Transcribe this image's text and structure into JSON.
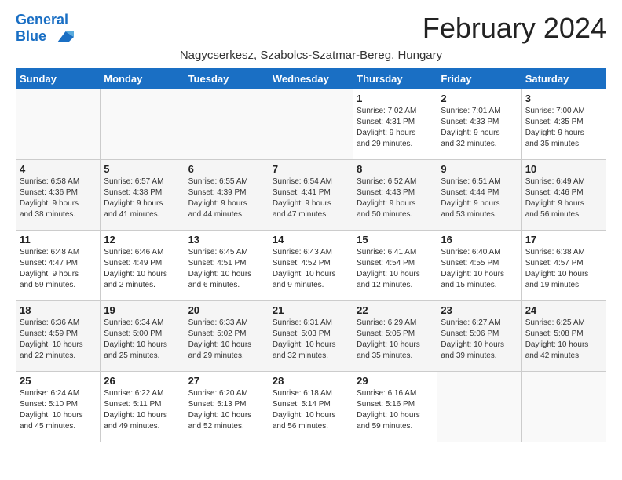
{
  "header": {
    "logo_line1": "General",
    "logo_line2": "Blue",
    "month_title": "February 2024",
    "location": "Nagycserkesz, Szabolcs-Szatmar-Bereg, Hungary"
  },
  "weekdays": [
    "Sunday",
    "Monday",
    "Tuesday",
    "Wednesday",
    "Thursday",
    "Friday",
    "Saturday"
  ],
  "weeks": [
    [
      {
        "day": "",
        "info": ""
      },
      {
        "day": "",
        "info": ""
      },
      {
        "day": "",
        "info": ""
      },
      {
        "day": "",
        "info": ""
      },
      {
        "day": "1",
        "info": "Sunrise: 7:02 AM\nSunset: 4:31 PM\nDaylight: 9 hours\nand 29 minutes."
      },
      {
        "day": "2",
        "info": "Sunrise: 7:01 AM\nSunset: 4:33 PM\nDaylight: 9 hours\nand 32 minutes."
      },
      {
        "day": "3",
        "info": "Sunrise: 7:00 AM\nSunset: 4:35 PM\nDaylight: 9 hours\nand 35 minutes."
      }
    ],
    [
      {
        "day": "4",
        "info": "Sunrise: 6:58 AM\nSunset: 4:36 PM\nDaylight: 9 hours\nand 38 minutes."
      },
      {
        "day": "5",
        "info": "Sunrise: 6:57 AM\nSunset: 4:38 PM\nDaylight: 9 hours\nand 41 minutes."
      },
      {
        "day": "6",
        "info": "Sunrise: 6:55 AM\nSunset: 4:39 PM\nDaylight: 9 hours\nand 44 minutes."
      },
      {
        "day": "7",
        "info": "Sunrise: 6:54 AM\nSunset: 4:41 PM\nDaylight: 9 hours\nand 47 minutes."
      },
      {
        "day": "8",
        "info": "Sunrise: 6:52 AM\nSunset: 4:43 PM\nDaylight: 9 hours\nand 50 minutes."
      },
      {
        "day": "9",
        "info": "Sunrise: 6:51 AM\nSunset: 4:44 PM\nDaylight: 9 hours\nand 53 minutes."
      },
      {
        "day": "10",
        "info": "Sunrise: 6:49 AM\nSunset: 4:46 PM\nDaylight: 9 hours\nand 56 minutes."
      }
    ],
    [
      {
        "day": "11",
        "info": "Sunrise: 6:48 AM\nSunset: 4:47 PM\nDaylight: 9 hours\nand 59 minutes."
      },
      {
        "day": "12",
        "info": "Sunrise: 6:46 AM\nSunset: 4:49 PM\nDaylight: 10 hours\nand 2 minutes."
      },
      {
        "day": "13",
        "info": "Sunrise: 6:45 AM\nSunset: 4:51 PM\nDaylight: 10 hours\nand 6 minutes."
      },
      {
        "day": "14",
        "info": "Sunrise: 6:43 AM\nSunset: 4:52 PM\nDaylight: 10 hours\nand 9 minutes."
      },
      {
        "day": "15",
        "info": "Sunrise: 6:41 AM\nSunset: 4:54 PM\nDaylight: 10 hours\nand 12 minutes."
      },
      {
        "day": "16",
        "info": "Sunrise: 6:40 AM\nSunset: 4:55 PM\nDaylight: 10 hours\nand 15 minutes."
      },
      {
        "day": "17",
        "info": "Sunrise: 6:38 AM\nSunset: 4:57 PM\nDaylight: 10 hours\nand 19 minutes."
      }
    ],
    [
      {
        "day": "18",
        "info": "Sunrise: 6:36 AM\nSunset: 4:59 PM\nDaylight: 10 hours\nand 22 minutes."
      },
      {
        "day": "19",
        "info": "Sunrise: 6:34 AM\nSunset: 5:00 PM\nDaylight: 10 hours\nand 25 minutes."
      },
      {
        "day": "20",
        "info": "Sunrise: 6:33 AM\nSunset: 5:02 PM\nDaylight: 10 hours\nand 29 minutes."
      },
      {
        "day": "21",
        "info": "Sunrise: 6:31 AM\nSunset: 5:03 PM\nDaylight: 10 hours\nand 32 minutes."
      },
      {
        "day": "22",
        "info": "Sunrise: 6:29 AM\nSunset: 5:05 PM\nDaylight: 10 hours\nand 35 minutes."
      },
      {
        "day": "23",
        "info": "Sunrise: 6:27 AM\nSunset: 5:06 PM\nDaylight: 10 hours\nand 39 minutes."
      },
      {
        "day": "24",
        "info": "Sunrise: 6:25 AM\nSunset: 5:08 PM\nDaylight: 10 hours\nand 42 minutes."
      }
    ],
    [
      {
        "day": "25",
        "info": "Sunrise: 6:24 AM\nSunset: 5:10 PM\nDaylight: 10 hours\nand 45 minutes."
      },
      {
        "day": "26",
        "info": "Sunrise: 6:22 AM\nSunset: 5:11 PM\nDaylight: 10 hours\nand 49 minutes."
      },
      {
        "day": "27",
        "info": "Sunrise: 6:20 AM\nSunset: 5:13 PM\nDaylight: 10 hours\nand 52 minutes."
      },
      {
        "day": "28",
        "info": "Sunrise: 6:18 AM\nSunset: 5:14 PM\nDaylight: 10 hours\nand 56 minutes."
      },
      {
        "day": "29",
        "info": "Sunrise: 6:16 AM\nSunset: 5:16 PM\nDaylight: 10 hours\nand 59 minutes."
      },
      {
        "day": "",
        "info": ""
      },
      {
        "day": "",
        "info": ""
      }
    ]
  ]
}
